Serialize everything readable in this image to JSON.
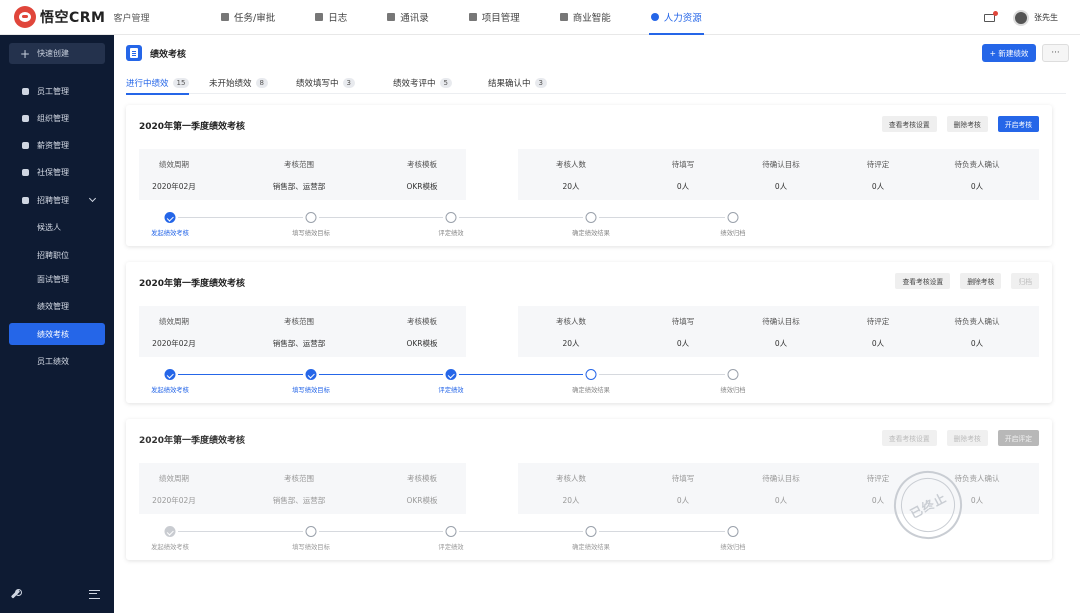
{
  "app": {
    "logo_text": "悟空CRM",
    "subtitle": "客户管理"
  },
  "topnav": [
    {
      "label": "任务/审批",
      "icon": "task-icon",
      "active": false
    },
    {
      "label": "日志",
      "icon": "log-icon",
      "active": false
    },
    {
      "label": "通讯录",
      "icon": "contacts-icon",
      "active": false
    },
    {
      "label": "项目管理",
      "icon": "project-icon",
      "active": false
    },
    {
      "label": "商业智能",
      "icon": "bi-icon",
      "active": false
    },
    {
      "label": "人力资源",
      "icon": "hr-icon",
      "active": true
    }
  ],
  "user": {
    "name": "张先生"
  },
  "sidebar": {
    "quick_create": "快速创建",
    "items": [
      {
        "label": "员工管理",
        "icon": "person-icon"
      },
      {
        "label": "组织管理",
        "icon": "org-icon"
      },
      {
        "label": "薪资管理",
        "icon": "salary-icon"
      },
      {
        "label": "社保管理",
        "icon": "insurance-icon"
      },
      {
        "label": "招聘管理",
        "icon": "recruit-icon"
      }
    ],
    "sub_items": [
      {
        "label": "候选人"
      },
      {
        "label": "招聘职位"
      },
      {
        "label": "面试管理"
      },
      {
        "label": "绩效管理"
      },
      {
        "label": "绩效考核",
        "active": true
      },
      {
        "label": "员工绩效"
      }
    ]
  },
  "page": {
    "title": "绩效考核",
    "new_button": "+ 新建绩效",
    "more_button": "···"
  },
  "tabs": [
    {
      "label": "进行中绩效",
      "count": "15",
      "active": true
    },
    {
      "label": "未开始绩效",
      "count": "8",
      "active": false
    },
    {
      "label": "绩效填写中",
      "count": "3",
      "active": false
    },
    {
      "label": "绩效考评中",
      "count": "5",
      "active": false
    },
    {
      "label": "结果确认中",
      "count": "3",
      "active": false
    }
  ],
  "info_headers_left": [
    "绩效周期",
    "考核范围",
    "考核模板"
  ],
  "info_headers_right": [
    "考核人数",
    "待填写",
    "待确认目标",
    "待评定",
    "待负责人确认"
  ],
  "step_labels": [
    "发起绩效考核",
    "填写绩效目标",
    "评定绩效",
    "确定绩效结果",
    "绩效归档"
  ],
  "cards": [
    {
      "title": "2020年第一季度绩效考核",
      "buttons": [
        {
          "label": "查看考核设置",
          "style": "default"
        },
        {
          "label": "删除考核",
          "style": "default"
        },
        {
          "label": "开启考核",
          "style": "primary"
        }
      ],
      "values_left": [
        "2020年02月",
        "销售部、运营部",
        "OKR模板"
      ],
      "values_right": [
        "20人",
        "0人",
        "0人",
        "0人",
        "0人"
      ],
      "progress_done": 1,
      "status": "active",
      "stamp": ""
    },
    {
      "title": "2020年第一季度绩效考核",
      "buttons": [
        {
          "label": "查看考核设置",
          "style": "default"
        },
        {
          "label": "删除考核",
          "style": "default"
        },
        {
          "label": "归档",
          "style": "disabled"
        }
      ],
      "values_left": [
        "2020年02月",
        "销售部、运营部",
        "OKR模板"
      ],
      "values_right": [
        "20人",
        "0人",
        "0人",
        "0人",
        "0人"
      ],
      "progress_done": 3,
      "status": "active",
      "stamp": ""
    },
    {
      "title": "2020年第一季度绩效考核",
      "buttons": [
        {
          "label": "查看考核设置",
          "style": "disabled"
        },
        {
          "label": "删除考核",
          "style": "disabled"
        },
        {
          "label": "开启评定",
          "style": "gray"
        }
      ],
      "values_left": [
        "2020年02月",
        "销售部、运营部",
        "OKR模板"
      ],
      "values_right": [
        "20人",
        "0人",
        "0人",
        "0人",
        "0人"
      ],
      "progress_done": 1,
      "status": "terminated",
      "stamp": "已终止"
    }
  ]
}
